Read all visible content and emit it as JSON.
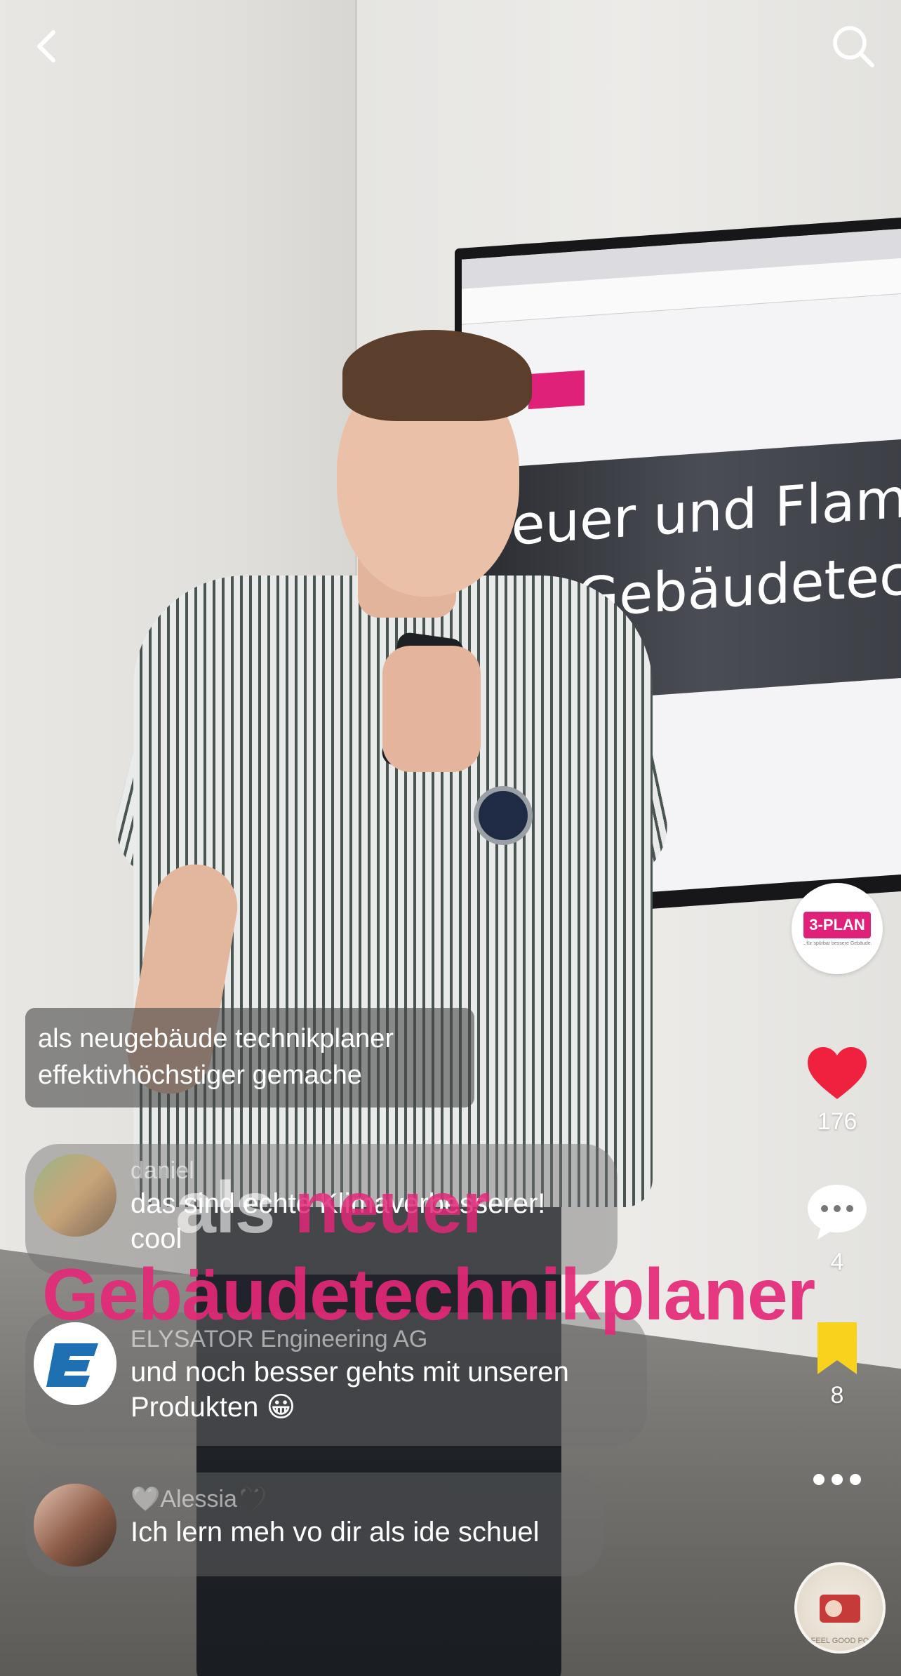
{
  "header": {
    "back_icon": "chevron-left-icon",
    "search_icon": "search-icon"
  },
  "caption": {
    "line1": "als neugebäude technikplaner",
    "line2": "effektivhöchstiger gemache"
  },
  "comments": [
    {
      "name": "daniel",
      "text_line1": "das sind echte Klimaverbesserer!",
      "text_line2": "cool",
      "avatar_icon": "avatar-photo"
    },
    {
      "name": "ELYSATOR Engineering AG",
      "text_line1": "und noch besser gehts mit unseren",
      "text_line2": "Produkten 😀",
      "avatar_icon": "elysator-logo",
      "avatar_letter": "E"
    },
    {
      "name": "🤍Alessia🖤",
      "text_line1": "Ich lern meh vo dir als ide schuel",
      "avatar_icon": "avatar-photo"
    }
  ],
  "video_overlay": {
    "word1": "als",
    "word2": "neuer",
    "line2": "Gebäudetechnikplaner"
  },
  "tv_screen": {
    "headline1": "Feuer und Flamm",
    "headline2": "für Gebäudetechn"
  },
  "sidebar": {
    "profile_badge": "3-PLAN",
    "profile_tagline": "...für spürbar bessere Gebäude.",
    "likes": "176",
    "comments": "4",
    "saves": "8",
    "music_label": "FEEL GOOD PO"
  },
  "colors": {
    "like": "#f0213f",
    "save": "#f8d21c",
    "brand": "#e0217a"
  }
}
